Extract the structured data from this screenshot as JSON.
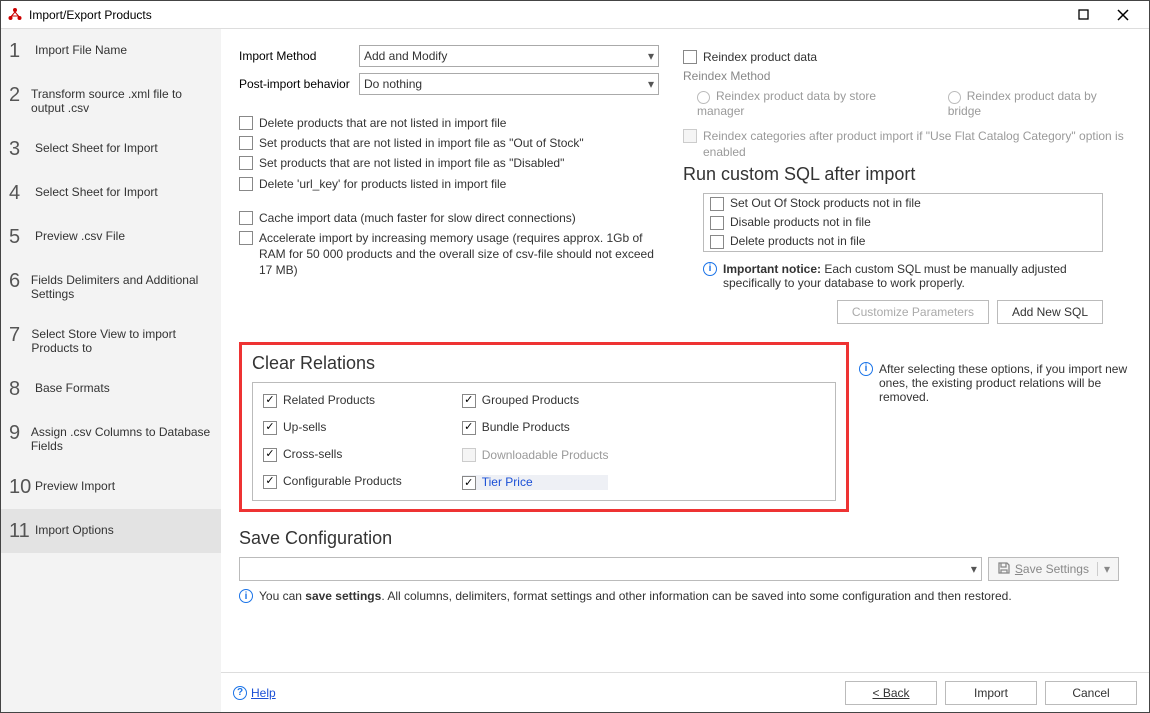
{
  "window": {
    "title": "Import/Export Products"
  },
  "sidebar": {
    "steps": [
      {
        "num": "1",
        "label": "Import File Name"
      },
      {
        "num": "2",
        "label": "Transform source .xml file to output .csv"
      },
      {
        "num": "3",
        "label": "Select Sheet for Import"
      },
      {
        "num": "4",
        "label": "Select Sheet for Import"
      },
      {
        "num": "5",
        "label": "Preview .csv File"
      },
      {
        "num": "6",
        "label": "Fields Delimiters and Additional Settings"
      },
      {
        "num": "7",
        "label": "Select Store View to import Products to"
      },
      {
        "num": "8",
        "label": "Base Formats"
      },
      {
        "num": "9",
        "label": "Assign .csv Columns to Database Fields"
      },
      {
        "num": "10",
        "label": "Preview Import"
      },
      {
        "num": "11",
        "label": "Import Options"
      }
    ]
  },
  "import": {
    "method_label": "Import Method",
    "method_value": "Add and Modify",
    "post_label": "Post-import behavior",
    "post_value": "Do nothing",
    "delete_unlisted": "Delete products that are not listed in import file",
    "set_oos": "Set products that are not listed in import file as \"Out of Stock\"",
    "set_disabled": "Set products that are not listed in import file as \"Disabled\"",
    "delete_urlkey": "Delete 'url_key' for products listed in import file",
    "cache_import": "Cache import data (much faster for slow direct connections)",
    "accelerate": "Accelerate import by increasing memory usage (requires approx. 1Gb of RAM for 50 000 products and the overall size of csv-file should not exceed 17 MB)"
  },
  "reindex": {
    "checkbox": "Reindex product data",
    "method_label": "Reindex Method",
    "radio_store": "Reindex product data by store manager",
    "radio_bridge": "Reindex product data by bridge",
    "flat_cat": "Reindex categories after product import if \"Use Flat Catalog Category\" option is enabled"
  },
  "sql": {
    "title": "Run custom SQL after import",
    "items": [
      "Set Out Of Stock products not in file",
      "Disable products not in file",
      "Delete products not in file"
    ],
    "notice_bold": "Important notice:",
    "notice_rest": " Each custom SQL must be manually adjusted specifically to your database to work properly.",
    "btn_customize": "Customize Parameters",
    "btn_add": "Add New SQL"
  },
  "relations": {
    "title": "Clear Relations",
    "left": [
      "Related Products",
      "Up-sells",
      "Cross-sells",
      "Configurable Products"
    ],
    "right": [
      "Grouped Products",
      "Bundle Products",
      "Downloadable Products",
      "Tier Price"
    ],
    "side_note": "After selecting these options, if you import new ones, the existing product relations will be removed."
  },
  "save": {
    "title": "Save Configuration",
    "button": "Save Settings",
    "note_prefix": "You can ",
    "note_bold": "save settings",
    "note_rest": ". All columns, delimiters, format settings and other information can be saved into some configuration and then restored."
  },
  "footer": {
    "help": "Help",
    "back": "< Back",
    "import": "Import",
    "cancel": "Cancel"
  }
}
